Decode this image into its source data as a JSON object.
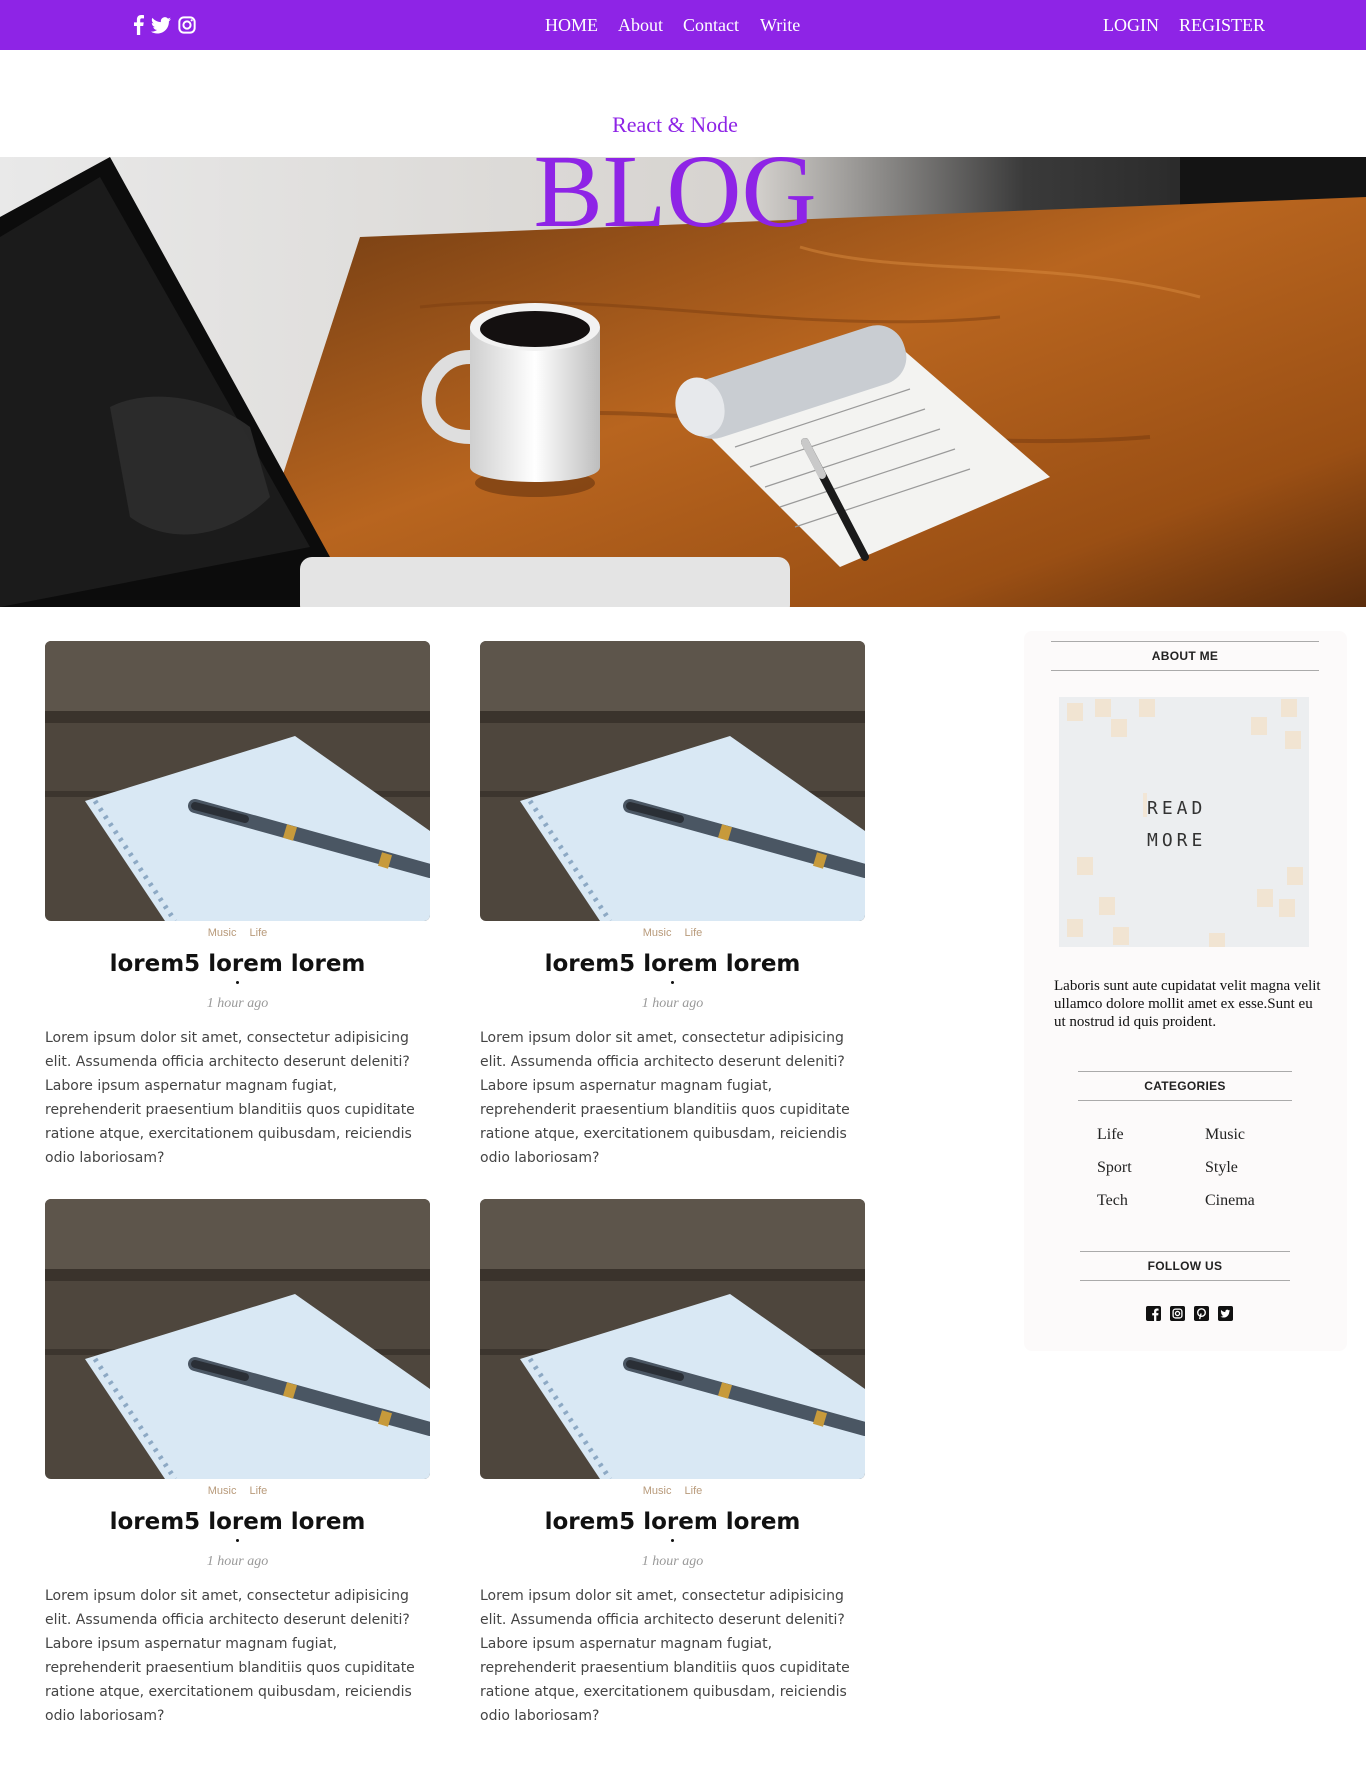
{
  "topbar": {
    "social_icons": [
      "facebook-icon",
      "twitter-icon",
      "instagram-icon"
    ],
    "nav": [
      "HOME",
      "About",
      "Contact",
      "Write"
    ],
    "auth": [
      "LOGIN",
      "REGISTER"
    ],
    "color": "#8e24e6"
  },
  "header": {
    "subtitle": "React & Node",
    "title": "BLOG",
    "accent": "#8e24e6"
  },
  "posts": [
    {
      "categories": [
        "Music",
        "Life"
      ],
      "title": "lorem5 lorem lorem",
      "date": "1 hour ago",
      "desc": "Lorem ipsum dolor sit amet, consectetur adipisicing elit. Assumenda officia architecto deserunt deleniti? Labore ipsum aspernatur magnam fugiat, reprehenderit praesentium blanditiis quos cupiditate ratione atque, exercitationem quibusdam, reiciendis odio laboriosam?"
    },
    {
      "categories": [
        "Music",
        "Life"
      ],
      "title": "lorem5 lorem lorem",
      "date": "1 hour ago",
      "desc": "Lorem ipsum dolor sit amet, consectetur adipisicing elit. Assumenda officia architecto deserunt deleniti? Labore ipsum aspernatur magnam fugiat, reprehenderit praesentium blanditiis quos cupiditate ratione atque, exercitationem quibusdam, reiciendis odio laboriosam?"
    },
    {
      "categories": [
        "Music",
        "Life"
      ],
      "title": "lorem5 lorem lorem",
      "date": "1 hour ago",
      "desc": "Lorem ipsum dolor sit amet, consectetur adipisicing elit. Assumenda officia architecto deserunt deleniti? Labore ipsum aspernatur magnam fugiat, reprehenderit praesentium blanditiis quos cupiditate ratione atque, exercitationem quibusdam, reiciendis odio laboriosam?"
    },
    {
      "categories": [
        "Music",
        "Life"
      ],
      "title": "lorem5 lorem lorem",
      "date": "1 hour ago",
      "desc": "Lorem ipsum dolor sit amet, consectetur adipisicing elit. Assumenda officia architecto deserunt deleniti? Labore ipsum aspernatur magnam fugiat, reprehenderit praesentium blanditiis quos cupiditate ratione atque, exercitationem quibusdam, reiciendis odio laboriosam?"
    }
  ],
  "sidebar": {
    "about_title": "ABOUT ME",
    "about_image_text": [
      "READ",
      "MORE"
    ],
    "about_text": "Laboris sunt aute cupidatat velit magna velit ullamco dolore mollit amet ex esse.Sunt eu ut nostrud id quis proident.",
    "categories_title": "CATEGORIES",
    "categories": [
      "Life",
      "Music",
      "Sport",
      "Style",
      "Tech",
      "Cinema"
    ],
    "follow_title": "FOLLOW US",
    "follow_icons": [
      "facebook-square-icon",
      "instagram-square-icon",
      "pinterest-square-icon",
      "twitter-square-icon"
    ]
  }
}
